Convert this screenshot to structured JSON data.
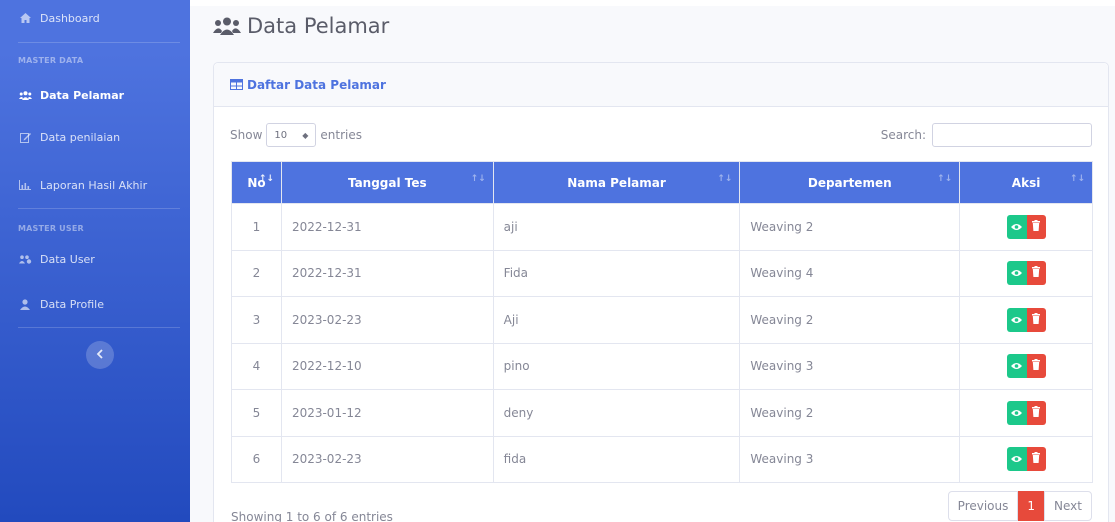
{
  "sidebar": {
    "items": [
      {
        "label": "Dashboard",
        "icon": "home-icon"
      },
      {
        "heading": "MASTER DATA"
      },
      {
        "label": "Data Pelamar",
        "icon": "users-icon",
        "active": true
      },
      {
        "label": "Data penilaian",
        "icon": "edit-icon"
      },
      {
        "label": "Laporan Hasil Akhir",
        "icon": "chart-icon"
      },
      {
        "heading": "MASTER USER"
      },
      {
        "label": "Data User",
        "icon": "users-cog-icon"
      },
      {
        "label": "Data Profile",
        "icon": "user-icon"
      }
    ],
    "toggle_icon": "chevron-left-icon"
  },
  "page": {
    "title": "Data Pelamar"
  },
  "card": {
    "header": "Daftar Data Pelamar"
  },
  "controls": {
    "show_label": "Show",
    "entries_value": "10",
    "entries_label": "entries",
    "search_label": "Search:",
    "search_value": ""
  },
  "table": {
    "columns": [
      "No",
      "Tanggal Tes",
      "Nama Pelamar",
      "Departemen",
      "Aksi"
    ],
    "rows": [
      {
        "no": "1",
        "tanggal": "2022-12-31",
        "nama": "aji",
        "departemen": "Weaving 2"
      },
      {
        "no": "2",
        "tanggal": "2022-12-31",
        "nama": "Fida",
        "departemen": "Weaving 4"
      },
      {
        "no": "3",
        "tanggal": "2023-02-23",
        "nama": "Aji",
        "departemen": "Weaving 2"
      },
      {
        "no": "4",
        "tanggal": "2022-12-10",
        "nama": "pino",
        "departemen": "Weaving 3"
      },
      {
        "no": "5",
        "tanggal": "2023-01-12",
        "nama": "deny",
        "departemen": "Weaving 2"
      },
      {
        "no": "6",
        "tanggal": "2023-02-23",
        "nama": "fida",
        "departemen": "Weaving 3"
      }
    ]
  },
  "footer": {
    "info": "Showing 1 to 6 of 6 entries",
    "previous": "Previous",
    "page": "1",
    "next": "Next"
  },
  "colors": {
    "primary": "#4e73df",
    "success": "#1cc88a",
    "danger": "#e74a3b"
  }
}
